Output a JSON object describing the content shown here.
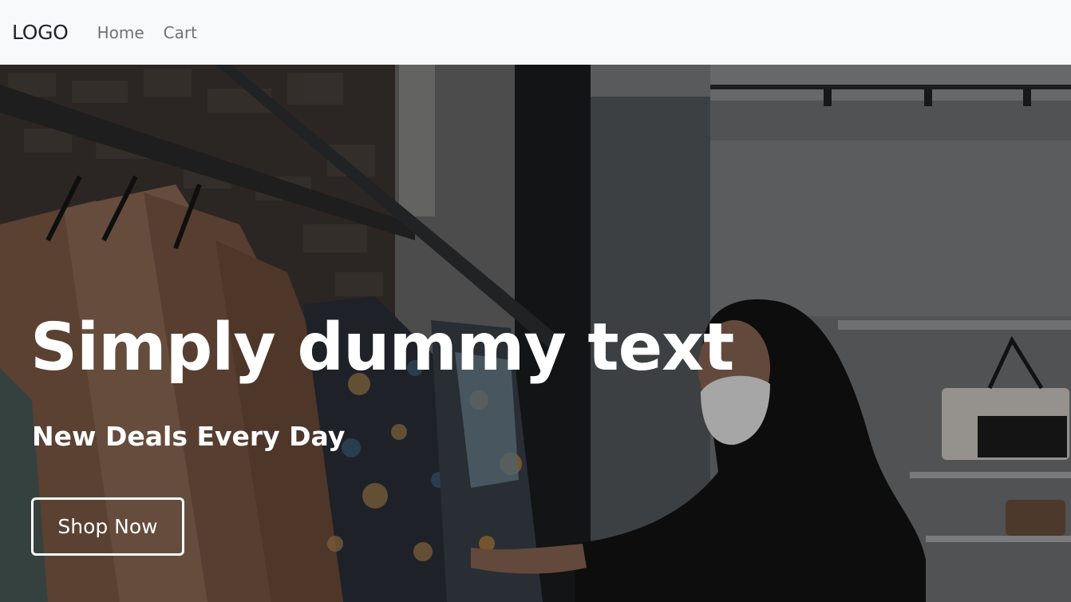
{
  "navbar": {
    "brand": "LOGO",
    "links": [
      {
        "label": "Home"
      },
      {
        "label": "Cart"
      }
    ]
  },
  "hero": {
    "background_image": "clothing-store-woman-with-mask-browsing-rack",
    "title": "Simply dummy text",
    "subtitle": "New Deals Every Day",
    "cta_label": "Shop Now"
  },
  "colors": {
    "navbar_bg": "#f8f9fa",
    "brand_text": "#212529",
    "nav_link": "#6c757d",
    "hero_text": "#ffffff"
  }
}
